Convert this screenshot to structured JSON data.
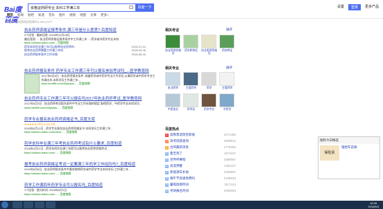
{
  "header": {
    "logo": "Bai度百度",
    "query": "资格证药研专业 本科工学满三年",
    "search_btn": "百度一下",
    "links": [
      "设置",
      "登录",
      "更多产品"
    ]
  },
  "tabs": [
    "网页",
    "新闻",
    "贴吧",
    "知道",
    "音乐",
    "图片",
    "视频",
    "地图",
    "文库",
    "更多»"
  ],
  "count": "百度为您找到相关结果约4,380,000个",
  "results": [
    {
      "title": "执业药师资格证报考条件,满三年是什么意思?-百度知道",
      "text": "4个回答 - 最新回答: 2016年10月28日",
      "text2": "最佳答案: ... 执业药师资格证报考条件中工作满三年 ... 药学或中药学专业本科",
      "url": "https://zhidao.baidu.com/ - 百度快照",
      "subs": [
        [
          "药学本科毕业满三年可以报考执业药师吗",
          "3个回答",
          "2015-07-22"
        ],
        [
          "报考执业药师需要工作满三年吗",
          "4个回答",
          "2016-04-26"
        ],
        [
          "执业药师报考条件工作年限",
          "1个回答",
          "2016-06-16"
        ]
      ]
    },
    {
      "title": "执业药师报名条件 药学专业工作满三年可以报名参加考试吗_...医学教育网",
      "text": "2017年6月8日 - 执业药师报名条件: 具备药学或中药学专业大专学历,从事药学或中药学专业工作满五年;本科学历工作满三年...",
      "url": "www.med66.com/zhiyeyao... - 百度快照"
    },
    {
      "title": "执业药师专业工作满三年可以报名吗2017年执业药师考试_医学教育网",
      "text": "2017年5月3日 - 执业药师考试报名条件中专业工作年限的规定 取得药学、中药学专业本科学历...",
      "url": "www.med66.com/zhiyeyao... - 百度快照"
    },
    {
      "title": "药学专业报名执业药师资格证书_百度文库",
      "text": "★★★★★ 评分:4.5/5 3页",
      "text2": "2015年5月12日 - 药学专业报名执业药师资格证书 本科学历工作满三年...",
      "url": "https://wenku.baidu.com/view/... - 百度快照"
    },
    {
      "title": "药学本科毕业满三年考执业药师考试有什么要求_百度知道",
      "text": "2016年4月21日 - 药学本科毕业满三年即可以报考执业药师资格考试 ...",
      "url": "https://zhidao.baidu.com/... - 百度快照"
    },
    {
      "title": "报考执业药师资格证考试一定要满三年药学工作经历吗?_百度知道",
      "text": "2015年8月8日 - 执业药师报名条件中要求取得药学或中药学专业本科学历,工作满三年 ...",
      "url": "https://zhidao.baidu.com/... - 百度快照"
    },
    {
      "title": "药学工作满四年药学专业可以报名吗_百度知道",
      "text": "1个回答 - 提问时间: 2016年6月1日",
      "url": "https://zhidao.baidu.com/... - 百度快照"
    }
  ],
  "right": {
    "sec1": "相关考证",
    "sec1_more": "展开",
    "sec1_items": [
      "执业药师资格证",
      "药学职称证",
      "执业医师资格证",
      "药剂师证"
    ],
    "sec2": "相关专业",
    "sec2_more": "展开",
    "sec2_items": [
      "执业药师",
      "主管药师",
      "药学",
      "主管药师",
      "中医执业",
      "药师证",
      "药学专业",
      "中药学"
    ],
    "sec3": "百度热点",
    "hot": [
      [
        "1",
        "高铁票退改签新规",
        "2271465"
      ],
      [
        "2",
        "高考成绩查询",
        "1908612"
      ],
      [
        "3",
        "台风最新消息",
        "1775354"
      ],
      [
        "4",
        "夏至到了",
        "1671157"
      ],
      [
        "5",
        "世界杯赛程",
        "1585657"
      ],
      [
        "6",
        "高温预警",
        "1463117"
      ],
      [
        "7",
        "新能源车补贴",
        "1350997"
      ],
      [
        "8",
        "端午节高速免费吗",
        "1236540"
      ],
      [
        "9",
        "暑假放假时间",
        "1117414"
      ],
      [
        "10",
        "考研报名时间",
        "1060063"
      ]
    ]
  },
  "ad": {
    "title": "搜狗今日精选",
    "line1": "理想车首辆",
    "line2": "保险贵"
  },
  "taskbar": {
    "time": "15:26",
    "date": "2016/5/3"
  }
}
